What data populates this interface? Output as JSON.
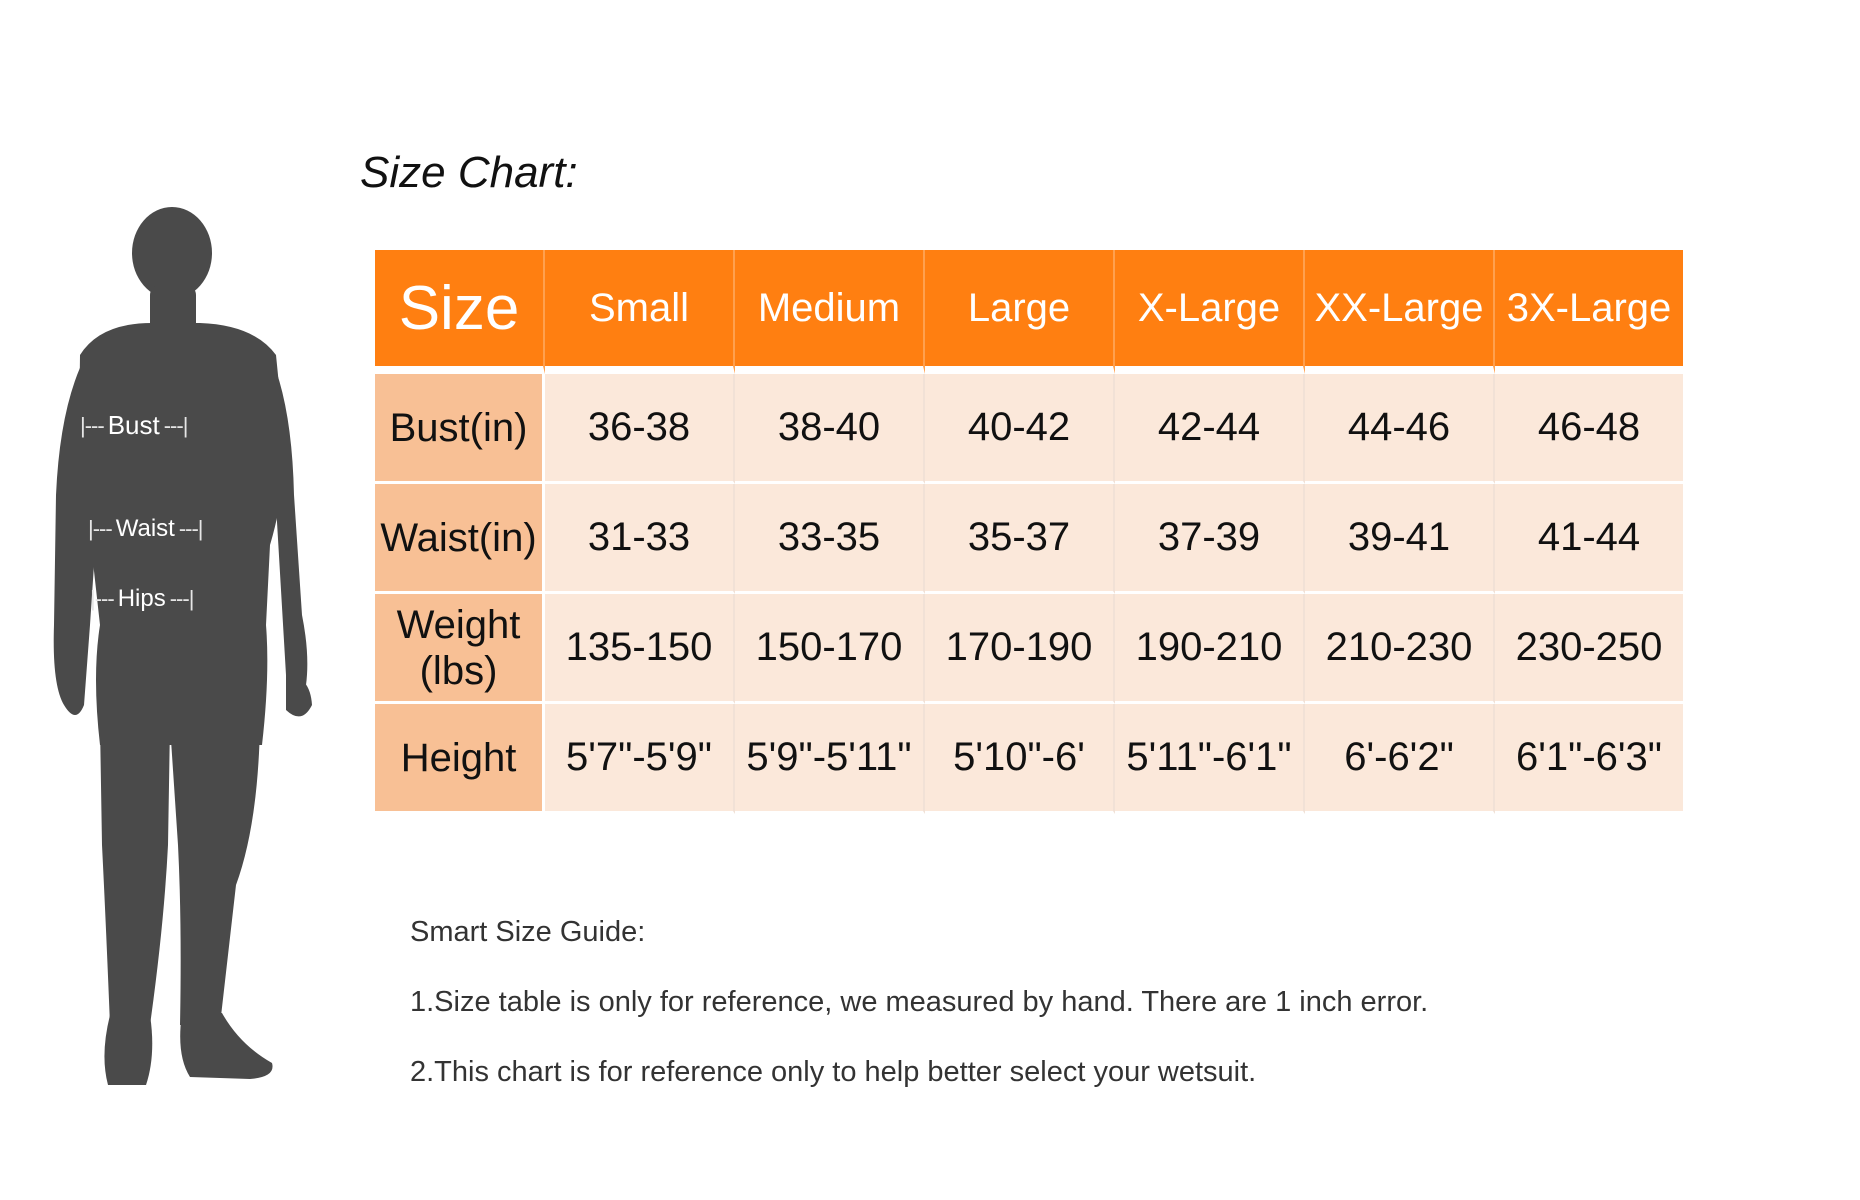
{
  "title": "Size Chart:",
  "figure": {
    "labels": [
      "Bust",
      "Waist",
      "Hips"
    ],
    "tick_left": "|---",
    "tick_right": "---|"
  },
  "table": {
    "corner": "Size",
    "columns": [
      "Small",
      "Medium",
      "Large",
      "X-Large",
      "XX-Large",
      "3X-Large"
    ],
    "rows": [
      {
        "label": "Bust(in)",
        "values": [
          "36-38",
          "38-40",
          "40-42",
          "42-44",
          "44-46",
          "46-48"
        ]
      },
      {
        "label": "Waist(in)",
        "values": [
          "31-33",
          "33-35",
          "35-37",
          "37-39",
          "39-41",
          "41-44"
        ]
      },
      {
        "label": "Weight (lbs)",
        "values": [
          "135-150",
          "150-170",
          "170-190",
          "190-210",
          "210-230",
          "230-250"
        ]
      },
      {
        "label": "Height",
        "values": [
          "5'7\"-5'9\"",
          "5'9\"-5'11\"",
          "5'10\"-6'",
          "5'11\"-6'1\"",
          "6'-6'2\"",
          "6'1\"-6'3\""
        ]
      }
    ]
  },
  "guide": {
    "heading": "Smart Size Guide:",
    "items": [
      "1.Size table is only for reference, we measured by hand. There are 1 inch error.",
      "2.This chart is for reference only to help better select your wetsuit."
    ]
  },
  "colors": {
    "header_orange": "#ff7f11",
    "row_label_peach": "#f8c095",
    "cell_cream": "#fbe8da",
    "silhouette": "#4a4a4a"
  },
  "icons": {
    "figure": "human-silhouette-icon"
  }
}
